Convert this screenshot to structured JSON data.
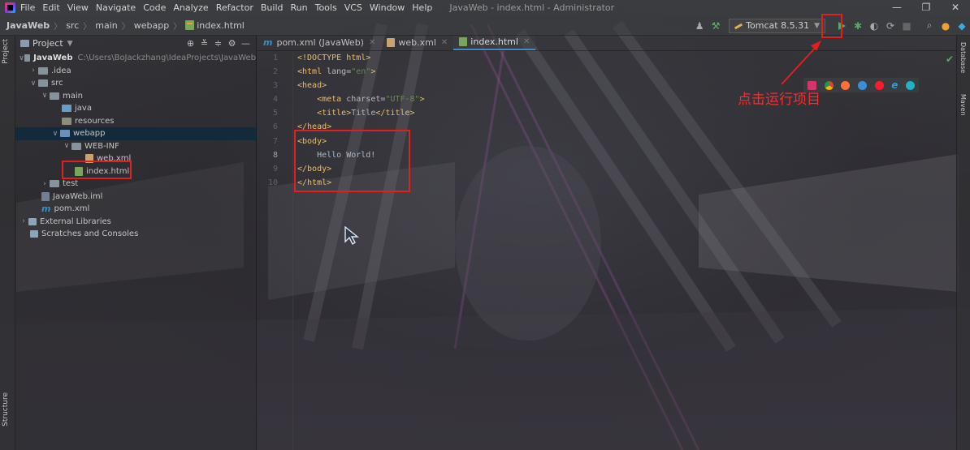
{
  "menubar": {
    "items": [
      "File",
      "Edit",
      "View",
      "Navigate",
      "Code",
      "Analyze",
      "Refactor",
      "Build",
      "Run",
      "Tools",
      "VCS",
      "Window",
      "Help"
    ],
    "window_title": "JavaWeb - index.html - Administrator"
  },
  "navbar": {
    "breadcrumbs": [
      "JavaWeb",
      "src",
      "main",
      "webapp",
      "index.html"
    ],
    "run_config": "Tomcat 8.5.31"
  },
  "side_tabs": {
    "project": "Project",
    "structure": "Structure",
    "database": "Database",
    "maven": "Maven"
  },
  "project_panel": {
    "title": "Project",
    "tree": [
      {
        "label": "JavaWeb",
        "hint": "C:\\Users\\BoJackzhang\\IdeaProjects\\JavaWeb"
      },
      {
        "label": ".idea"
      },
      {
        "label": "src"
      },
      {
        "label": "main"
      },
      {
        "label": "java"
      },
      {
        "label": "resources"
      },
      {
        "label": "webapp"
      },
      {
        "label": "WEB-INF"
      },
      {
        "label": "web.xml"
      },
      {
        "label": "index.html"
      },
      {
        "label": "test"
      },
      {
        "label": "JavaWeb.iml"
      },
      {
        "label": "pom.xml"
      },
      {
        "label": "External Libraries"
      },
      {
        "label": "Scratches and Consoles"
      }
    ]
  },
  "editor": {
    "tabs": [
      {
        "label": "pom.xml (JavaWeb)"
      },
      {
        "label": "web.xml"
      },
      {
        "label": "index.html"
      }
    ],
    "line_numbers": [
      "1",
      "2",
      "3",
      "4",
      "5",
      "6",
      "7",
      "8",
      "9",
      "10"
    ],
    "code": {
      "l1": "<!DOCTYPE html>",
      "l2_a": "<html ",
      "l2_b": "lang=",
      "l2_c": "\"en\"",
      "l2_d": ">",
      "l3": "<head>",
      "l4_a": "    <meta ",
      "l4_b": "charset=",
      "l4_c": "\"UTF-8\"",
      "l4_d": ">",
      "l5_a": "    <title>",
      "l5_b": "Title",
      "l5_c": "</title>",
      "l6": "</head>",
      "l7": "<body>",
      "l8": "    Hello World!",
      "l9": "</body>",
      "l10": "</html>"
    }
  },
  "annotation": {
    "text": "点击运行项目",
    "color": "#ff2a2a"
  },
  "colors": {
    "accent": "#4a88c7",
    "run_green": "#59a869",
    "highlight_red": "#e02020"
  }
}
